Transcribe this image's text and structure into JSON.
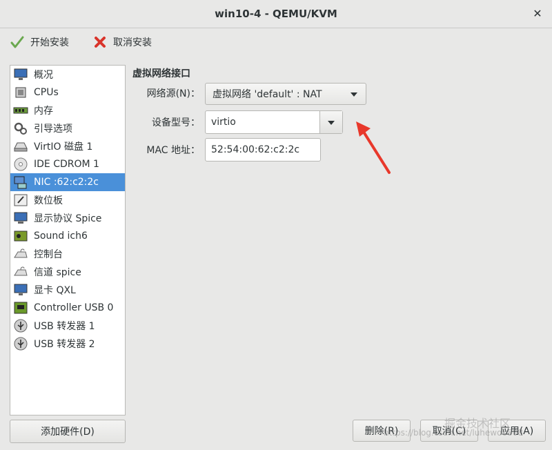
{
  "window": {
    "title": "win10-4 - QEMU/KVM"
  },
  "toolbar": {
    "begin_install": "开始安装",
    "cancel_install": "取消安装"
  },
  "sidebar": {
    "items": [
      {
        "label": "概况",
        "icon": "monitor-icon"
      },
      {
        "label": "CPUs",
        "icon": "cpu-chip-icon"
      },
      {
        "label": "内存",
        "icon": "memory-stick-icon"
      },
      {
        "label": "引导选项",
        "icon": "gears-icon"
      },
      {
        "label": "VirtIO 磁盘 1",
        "icon": "hard-disk-icon"
      },
      {
        "label": "IDE CDROM 1",
        "icon": "cdrom-icon"
      },
      {
        "label": "NIC :62:c2:2c",
        "icon": "network-card-icon",
        "selected": true
      },
      {
        "label": "数位板",
        "icon": "tablet-icon"
      },
      {
        "label": "显示协议  Spice",
        "icon": "display-icon"
      },
      {
        "label": "Sound ich6",
        "icon": "sound-card-icon"
      },
      {
        "label": "控制台",
        "icon": "serial-console-icon"
      },
      {
        "label": "信道  spice",
        "icon": "channel-icon"
      },
      {
        "label": "显卡  QXL",
        "icon": "video-card-icon"
      },
      {
        "label": "Controller USB 0",
        "icon": "controller-board-icon"
      },
      {
        "label": "USB 转发器  1",
        "icon": "usb-redirector-icon"
      },
      {
        "label": "USB 转发器  2",
        "icon": "usb-redirector-icon"
      }
    ],
    "add_hardware": "添加硬件(D)"
  },
  "nic": {
    "section_title": "虚拟网络接口",
    "source_label": "网络源(N)：",
    "source_value": "虚拟网络  'default' : NAT",
    "model_label": "设备型号：",
    "model_value": "virtio",
    "mac_label": "MAC 地址：",
    "mac_value": "52:54:00:62:c2:2c"
  },
  "footer": {
    "remove": "删除(R)",
    "cancel": "取消(C)",
    "apply": "应用(A)"
  },
  "watermark": {
    "url": "https://blog.csdn.net/luhewo0808",
    "brand": "掘金技术社区"
  },
  "colors": {
    "selection": "#4a90d9",
    "annotation_arrow": "#e8382b"
  }
}
